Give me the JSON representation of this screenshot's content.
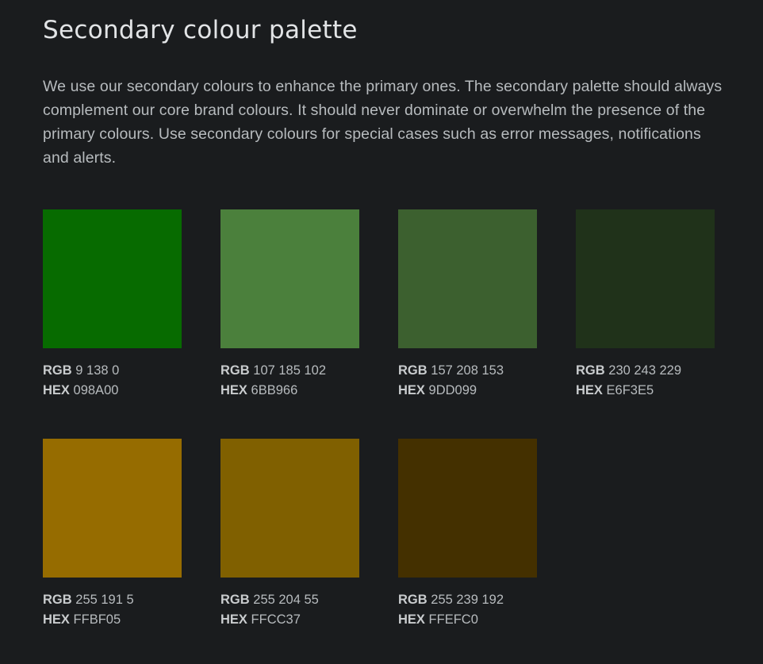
{
  "header": {
    "title": "Secondary colour palette"
  },
  "intro": {
    "text": "We use our secondary colours to enhance the primary ones. The secondary palette should always complement our core brand colours. It should never dominate or overwhelm the presence of the primary colours. Use secondary colours for special cases such as error messages, notifications and alerts."
  },
  "labels": {
    "rgb": "RGB",
    "hex": "HEX"
  },
  "swatches": [
    {
      "rgb": "9 138 0",
      "hex": "098A00",
      "display_color": "#076b00"
    },
    {
      "rgb": "107 185 102",
      "hex": "6BB966",
      "display_color": "#4b803c"
    },
    {
      "rgb": "157 208 153",
      "hex": "9DD099",
      "display_color": "#3c602f"
    },
    {
      "rgb": "230 243 229",
      "hex": "E6F3E5",
      "display_color": "#20321a"
    },
    {
      "rgb": "255 191 5",
      "hex": "FFBF05",
      "display_color": "#966c00"
    },
    {
      "rgb": "255 204 55",
      "hex": "FFCC37",
      "display_color": "#806000"
    },
    {
      "rgb": "255 239 192",
      "hex": "FFEFC0",
      "display_color": "#443000"
    }
  ]
}
